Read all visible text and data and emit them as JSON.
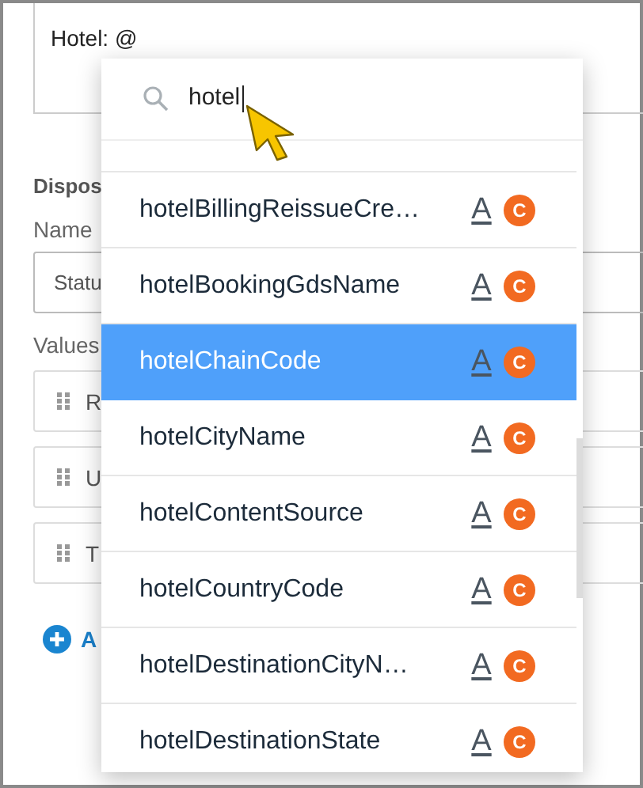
{
  "form": {
    "message_text": "Hotel: @",
    "section_title": "Dispos",
    "name_label": "Name",
    "name_value": "Statu",
    "values_label": "Values",
    "values": [
      {
        "text": "R"
      },
      {
        "text": "U"
      },
      {
        "text": "T"
      }
    ],
    "add_button": "A"
  },
  "dropdown": {
    "search_value": "hotel",
    "items": [
      {
        "label": "hotelBillingReissueCre…",
        "type_icon": "A",
        "badge": "C",
        "selected": false
      },
      {
        "label": "hotelBookingGdsName",
        "type_icon": "A",
        "badge": "C",
        "selected": false
      },
      {
        "label": "hotelChainCode",
        "type_icon": "A",
        "badge": "C",
        "selected": true
      },
      {
        "label": "hotelCityName",
        "type_icon": "A",
        "badge": "C",
        "selected": false
      },
      {
        "label": "hotelContentSource",
        "type_icon": "A",
        "badge": "C",
        "selected": false
      },
      {
        "label": "hotelCountryCode",
        "type_icon": "A",
        "badge": "C",
        "selected": false
      },
      {
        "label": "hotelDestinationCityN…",
        "type_icon": "A",
        "badge": "C",
        "selected": false
      },
      {
        "label": "hotelDestinationState",
        "type_icon": "A",
        "badge": "C",
        "selected": false
      }
    ]
  }
}
